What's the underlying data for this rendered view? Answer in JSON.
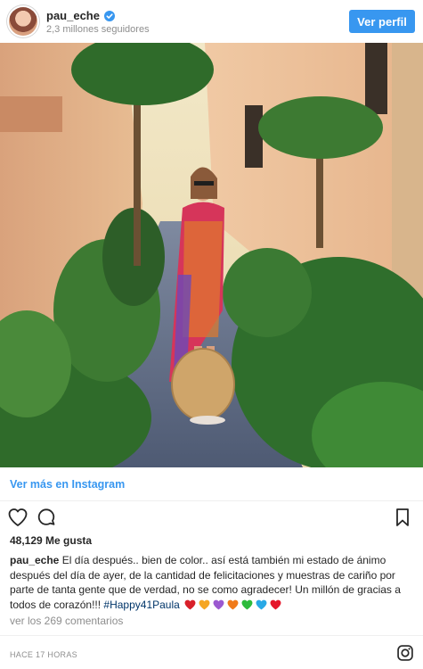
{
  "header": {
    "username": "pau_eche",
    "followers": "2,3 millones seguidores",
    "follow_button": "Ver perfil"
  },
  "photo": {
    "alt": "pau_eche"
  },
  "view_more": {
    "label": "Ver más en Instagram"
  },
  "actions": {
    "like_icon": "heart-icon",
    "comment_icon": "comment-icon",
    "save_icon": "bookmark-icon"
  },
  "likes": "48,129 Me gusta",
  "caption": {
    "username": "pau_eche",
    "text": "El día después.. bien de color.. así está también mi estado de ánimo después del día de ayer, de la cantidad de felicitaciones y muestras de cariño por parte de tanta gente que de verdad, no se como agradecer! Un millón de gracias a todos de corazón!!!",
    "hashtag": "#Happy41Paula",
    "heart_colors": [
      "#d8202a",
      "#f5a623",
      "#9b59d0",
      "#f07a1a",
      "#2dbb3c",
      "#29a9e6",
      "#e5162a"
    ]
  },
  "comments_link": "ver los 269 comentarios",
  "timestamp": "HACE 17 HORAS",
  "colors": {
    "accent": "#3897f0",
    "hashtag": "#003569",
    "muted": "#8e8e8e"
  }
}
